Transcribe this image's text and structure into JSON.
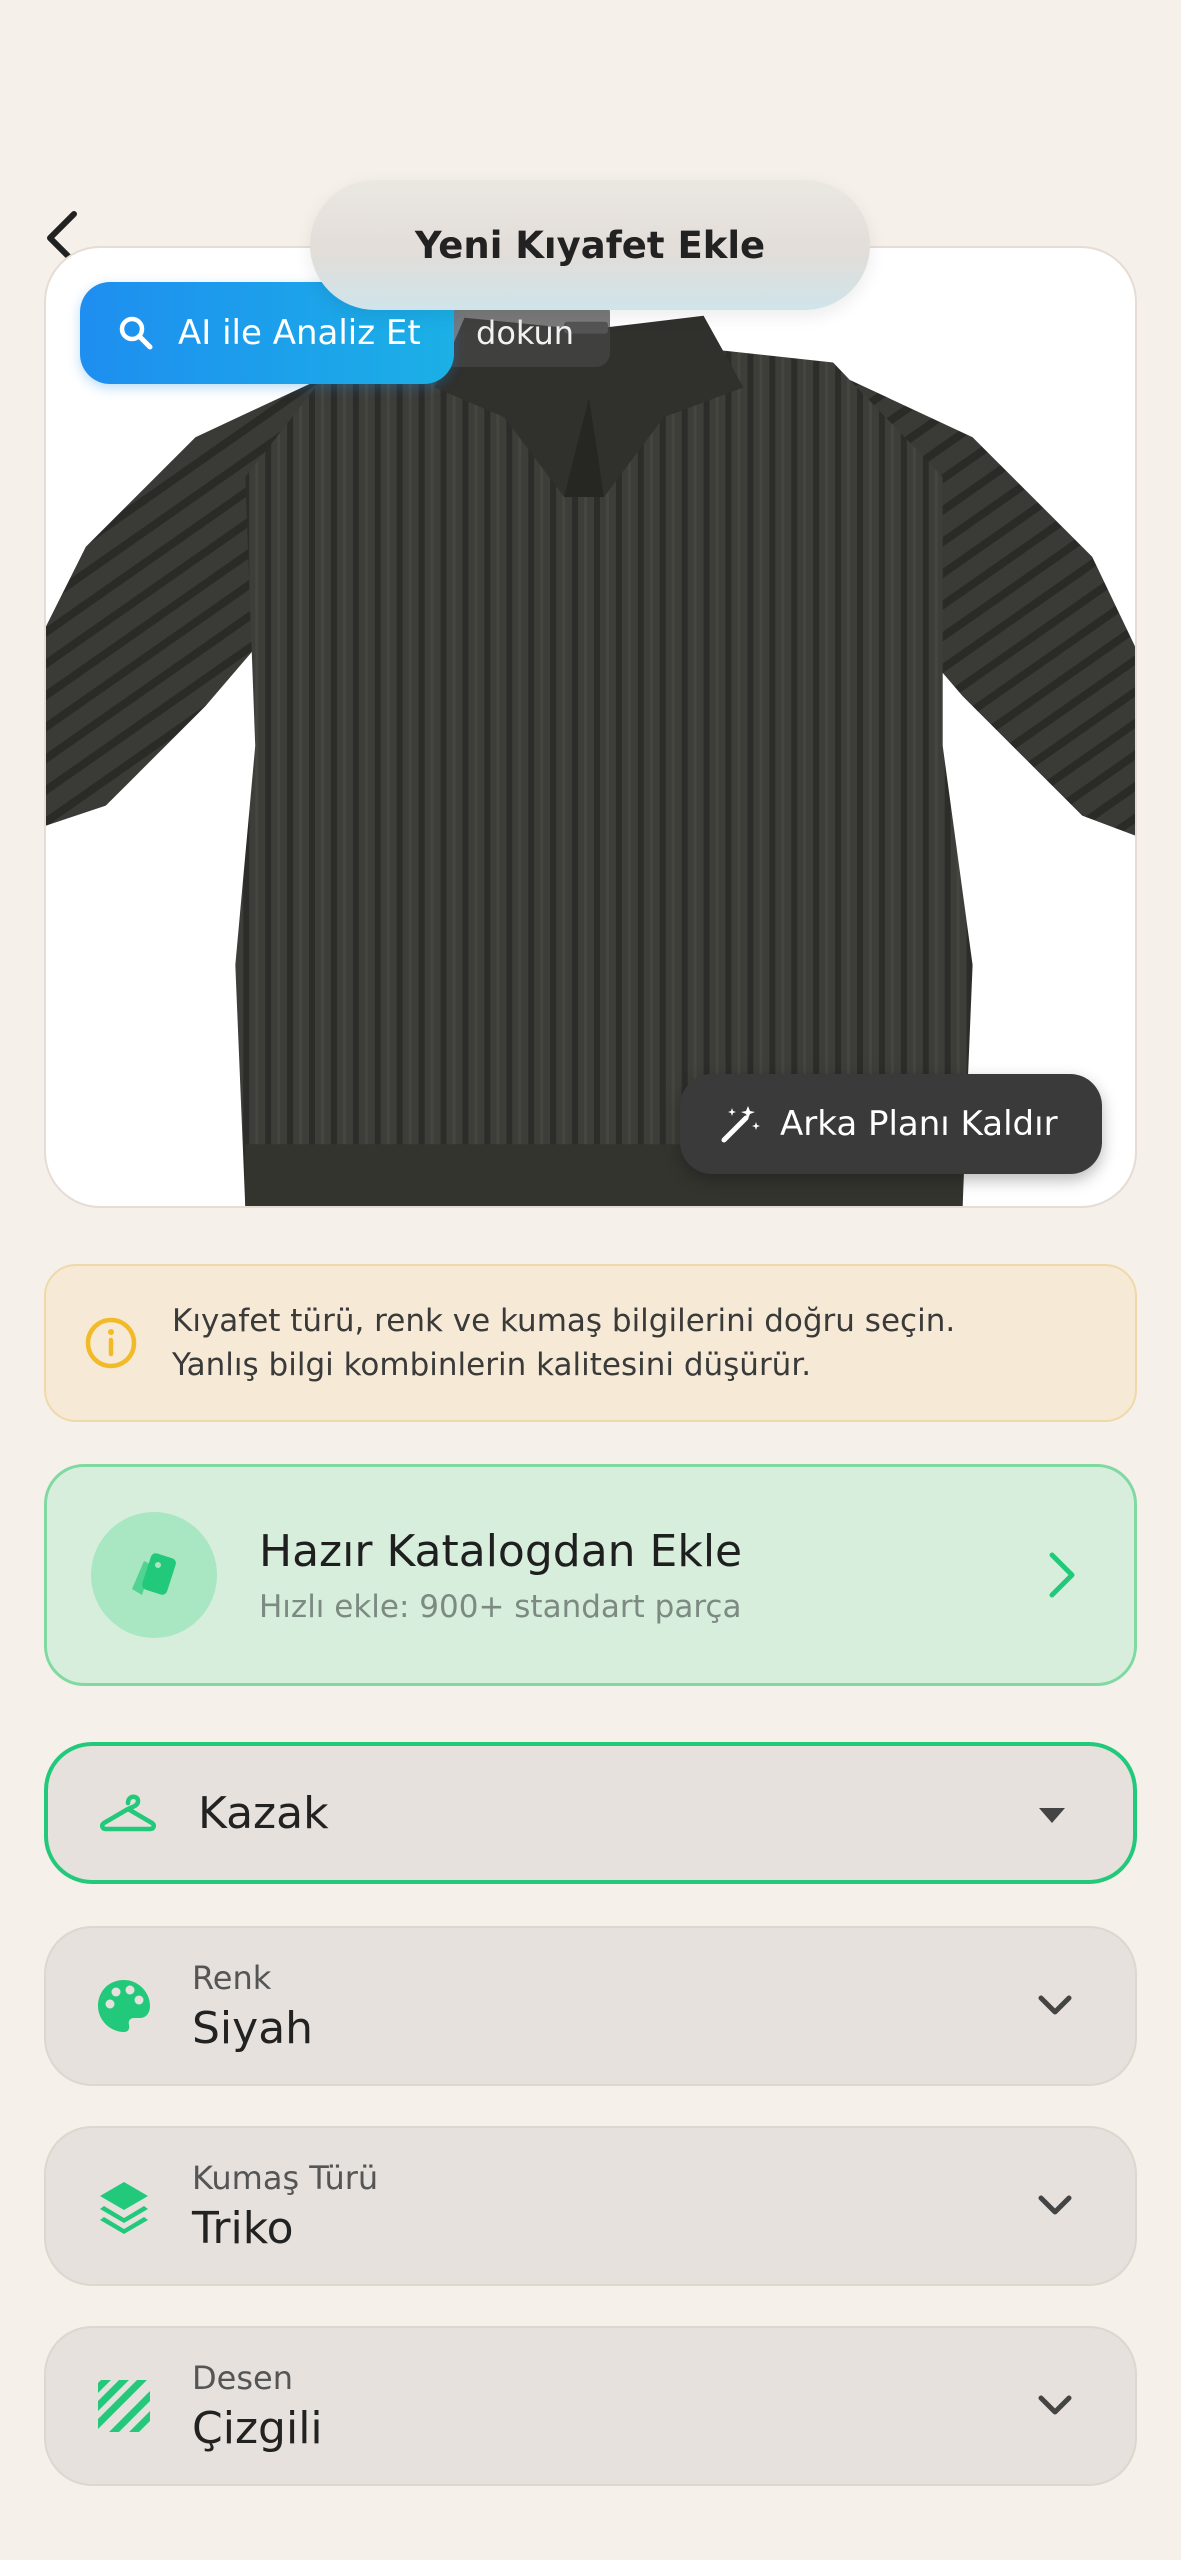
{
  "header": {
    "title": "Yeni Kıyafet Ekle"
  },
  "image_card": {
    "ai_button_label": "AI ile Analiz Et",
    "hint_text": "dokun",
    "remove_bg_label": "Arka Planı Kaldır"
  },
  "info": {
    "text_line1": "Kıyafet türü, renk ve kumaş bilgilerini doğru seçin.",
    "text_line2": "Yanlış bilgi kombinlerin kalitesini düşürür."
  },
  "catalog": {
    "title": "Hazır Katalogdan Ekle",
    "subtitle": "Hızlı ekle: 900+ standart parça"
  },
  "fields": {
    "type": {
      "value": "Kazak"
    },
    "color": {
      "label": "Renk",
      "value": "Siyah"
    },
    "fabric": {
      "label": "Kumaş Türü",
      "value": "Triko"
    },
    "pattern": {
      "label": "Desen",
      "value": "Çizgili"
    }
  },
  "colors": {
    "accent_green": "#22c97a",
    "ai_blue": "#1e8ef0",
    "warning_yellow": "#f2b928",
    "background": "#f5f0ea"
  },
  "icons": {
    "back": "chevron-left-icon",
    "search": "search-icon",
    "wand": "magic-wand-icon",
    "info": "info-icon",
    "catalog": "cards-icon",
    "hanger": "hanger-icon",
    "palette": "palette-icon",
    "layers": "layers-icon",
    "stripes": "stripes-icon"
  }
}
